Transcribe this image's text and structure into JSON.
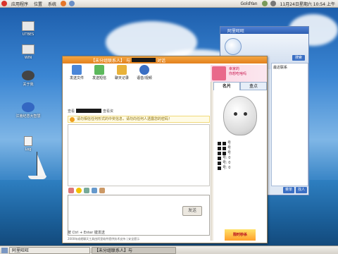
{
  "top_panel": {
    "menus": [
      "应用程序",
      "位置",
      "系统"
    ],
    "username": "GoldYan",
    "clock": "11月24日星期六 10:54 上午"
  },
  "desktop": {
    "icons": [
      {
        "name": "UTBES",
        "icon": "drive-icon"
      },
      {
        "name": "WIN",
        "icon": "drive-icon"
      },
      {
        "name": "关于我",
        "icon": "user-icon"
      },
      {
        "name": "江南纪念大智慧",
        "icon": "app-icon"
      },
      {
        "name": "Log",
        "icon": "file-icon"
      }
    ]
  },
  "qq_main": {
    "title": "阿里旺旺",
    "search_label": "搜索",
    "recent_label": "最近联系",
    "bottom_buttons": [
      "菜单",
      "找人"
    ]
  },
  "chat_window": {
    "title_prefix": "【",
    "title_contact": "未分组联系人",
    "title_suffix": "】 与",
    "title_end": "对话",
    "toolbar": [
      {
        "label": "发送文件",
        "icon": "send-file-icon"
      },
      {
        "label": "发送短信",
        "icon": "sms-icon"
      },
      {
        "label": "聊天记录",
        "icon": "history-icon"
      },
      {
        "label": "语音/视频",
        "icon": "voice-video-icon"
      }
    ],
    "ad_text_1": "幸家的",
    "ad_text_2": "你想吃啥吗",
    "contact_label": "查看",
    "status_text": "查看资",
    "notice": "请勿相信任何形式的中奖信息，请勿向任何人透露您的密码！",
    "send_button": "发送",
    "shortcut_hint": "按 Ctrl + Enter 键发送",
    "footer_hint": "2000年成就聊天工具由阿里软件提供技术支持 | 安全提示",
    "tabs": [
      "名片",
      "盒点"
    ],
    "info_rows": [
      "号",
      "号",
      "号",
      "号: 0",
      "号: 0",
      "号: 0"
    ],
    "promo": "限时秒杀"
  },
  "taskbar": {
    "items": [
      {
        "label": "阿里旺旺",
        "active": false
      },
      {
        "label": "【未分组联系人】与",
        "active": true
      }
    ]
  }
}
